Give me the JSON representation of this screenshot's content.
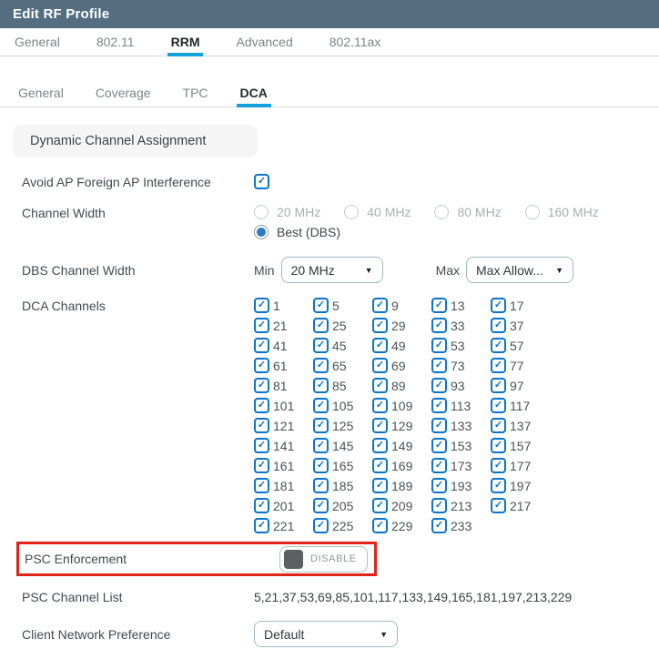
{
  "window": {
    "title": "Edit RF Profile"
  },
  "tabs": {
    "items": [
      {
        "label": "General",
        "active": false
      },
      {
        "label": "802.11",
        "active": false
      },
      {
        "label": "RRM",
        "active": true
      },
      {
        "label": "Advanced",
        "active": false
      },
      {
        "label": "802.11ax",
        "active": false
      }
    ]
  },
  "subtabs": {
    "items": [
      {
        "label": "General",
        "active": false
      },
      {
        "label": "Coverage",
        "active": false
      },
      {
        "label": "TPC",
        "active": false
      },
      {
        "label": "DCA",
        "active": true
      }
    ]
  },
  "section": {
    "title": "Dynamic Channel Assignment"
  },
  "form": {
    "avoid_ap": {
      "label": "Avoid AP Foreign AP Interference",
      "checked": true
    },
    "channel_width": {
      "label": "Channel Width",
      "disabled_options": [
        "20 MHz",
        "40 MHz",
        "80 MHz",
        "160 MHz"
      ],
      "selected_option": "Best (DBS)"
    },
    "dbs_width": {
      "label": "DBS Channel Width",
      "min_label": "Min",
      "min_value": "20 MHz",
      "max_label": "Max",
      "max_value": "Max Allow...",
      "caret": "▼"
    },
    "dca_channels": {
      "label": "DCA Channels",
      "all_checked": true,
      "channels": [
        1,
        5,
        9,
        13,
        17,
        21,
        25,
        29,
        33,
        37,
        41,
        45,
        49,
        53,
        57,
        61,
        65,
        69,
        73,
        77,
        81,
        85,
        89,
        93,
        97,
        101,
        105,
        109,
        113,
        117,
        121,
        125,
        129,
        133,
        137,
        141,
        145,
        149,
        153,
        157,
        161,
        165,
        169,
        173,
        177,
        181,
        185,
        189,
        193,
        197,
        201,
        205,
        209,
        213,
        217,
        221,
        225,
        229,
        233
      ]
    },
    "psc_enforcement": {
      "label": "PSC Enforcement",
      "toggle_state": "DISABLE"
    },
    "psc_channel_list": {
      "label": "PSC Channel List",
      "value": "5,21,37,53,69,85,101,117,133,149,165,181,197,213,229"
    },
    "client_network_preference": {
      "label": "Client Network Preference",
      "value": "Default",
      "caret": "▼"
    }
  },
  "colors": {
    "titlebar_slate": "#546e80",
    "accent_blue": "#14a0da",
    "checkbox_blue": "#0b74c9",
    "radio_blue": "#2b7dc2",
    "annotation_red": "#e2231a"
  }
}
